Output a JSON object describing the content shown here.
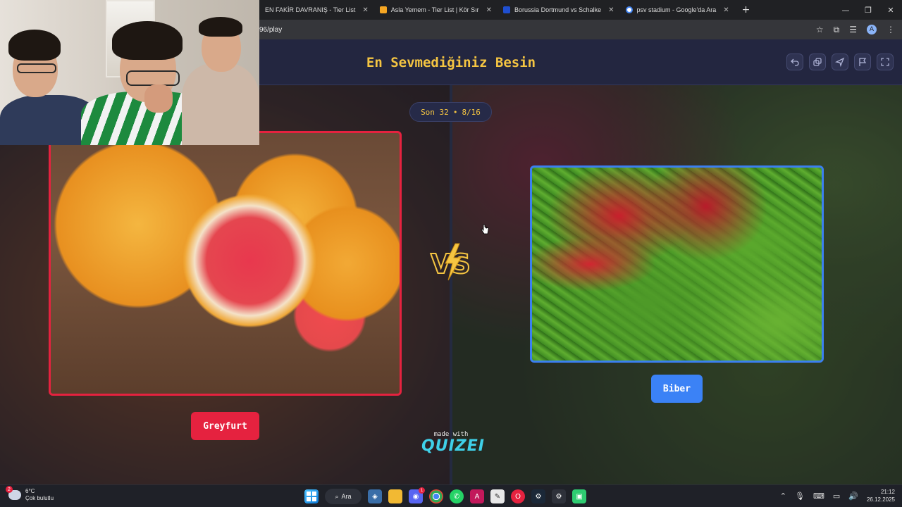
{
  "browser": {
    "tabs": [
      {
        "label": "EN FAKİR DAVRANIŞ - Tier List",
        "favicon_color": "#e34c26"
      },
      {
        "label": "Asla Yemem - Tier List | Kör Sır",
        "favicon_color": "#f5a623"
      },
      {
        "label": "Borussia Dortmund vs Schalke",
        "favicon_color": "#1f4fd1"
      },
      {
        "label": "psv stadium - Google'da Ara",
        "favicon_color": "#4285f4"
      }
    ],
    "close_glyph": "✕",
    "new_tab_glyph": "+",
    "url": "96/play",
    "profile_initial": "A"
  },
  "quiz": {
    "title": "En Sevmediğiniz Besin",
    "round": {
      "stage": "Son 32",
      "separator": "•",
      "progress": "8/16"
    },
    "left": {
      "label": "Greyfurt",
      "accent": "#e5223f"
    },
    "right": {
      "label": "Biber",
      "accent": "#3b82f6"
    },
    "vs_text": "VS",
    "footer": {
      "made_with": "made with",
      "brand": "QUIZEI"
    },
    "header_buttons": [
      "undo-icon",
      "share-icon",
      "send-icon",
      "flag-icon",
      "fullscreen-icon"
    ]
  },
  "taskbar": {
    "weather": {
      "temp": "6°C",
      "condition": "Çok bulutlu",
      "badge": "2"
    },
    "search_label": "Ara",
    "clock": {
      "time": "21:12",
      "date": "26.12.2025"
    },
    "discord_badge": "1"
  },
  "colors": {
    "title_gold": "#f5c542",
    "header_bg": "#232640",
    "quizei_cyan": "#3fd0e8"
  }
}
